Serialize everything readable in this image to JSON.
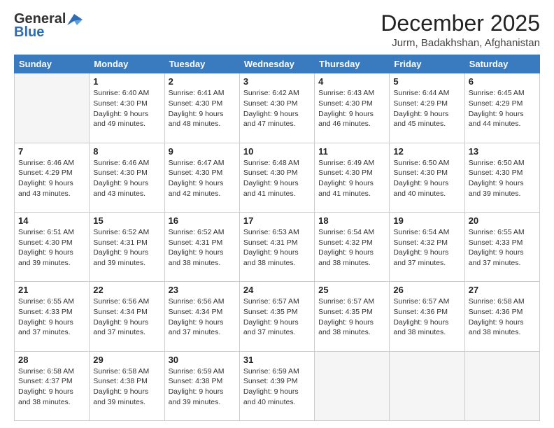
{
  "header": {
    "logo_line1": "General",
    "logo_line2": "Blue",
    "title": "December 2025",
    "subtitle": "Jurm, Badakhshan, Afghanistan"
  },
  "days_of_week": [
    "Sunday",
    "Monday",
    "Tuesday",
    "Wednesday",
    "Thursday",
    "Friday",
    "Saturday"
  ],
  "weeks": [
    [
      {
        "day": "",
        "info": ""
      },
      {
        "day": "1",
        "info": "Sunrise: 6:40 AM\nSunset: 4:30 PM\nDaylight: 9 hours\nand 49 minutes."
      },
      {
        "day": "2",
        "info": "Sunrise: 6:41 AM\nSunset: 4:30 PM\nDaylight: 9 hours\nand 48 minutes."
      },
      {
        "day": "3",
        "info": "Sunrise: 6:42 AM\nSunset: 4:30 PM\nDaylight: 9 hours\nand 47 minutes."
      },
      {
        "day": "4",
        "info": "Sunrise: 6:43 AM\nSunset: 4:30 PM\nDaylight: 9 hours\nand 46 minutes."
      },
      {
        "day": "5",
        "info": "Sunrise: 6:44 AM\nSunset: 4:29 PM\nDaylight: 9 hours\nand 45 minutes."
      },
      {
        "day": "6",
        "info": "Sunrise: 6:45 AM\nSunset: 4:29 PM\nDaylight: 9 hours\nand 44 minutes."
      }
    ],
    [
      {
        "day": "7",
        "info": "Sunrise: 6:46 AM\nSunset: 4:29 PM\nDaylight: 9 hours\nand 43 minutes."
      },
      {
        "day": "8",
        "info": "Sunrise: 6:46 AM\nSunset: 4:30 PM\nDaylight: 9 hours\nand 43 minutes."
      },
      {
        "day": "9",
        "info": "Sunrise: 6:47 AM\nSunset: 4:30 PM\nDaylight: 9 hours\nand 42 minutes."
      },
      {
        "day": "10",
        "info": "Sunrise: 6:48 AM\nSunset: 4:30 PM\nDaylight: 9 hours\nand 41 minutes."
      },
      {
        "day": "11",
        "info": "Sunrise: 6:49 AM\nSunset: 4:30 PM\nDaylight: 9 hours\nand 41 minutes."
      },
      {
        "day": "12",
        "info": "Sunrise: 6:50 AM\nSunset: 4:30 PM\nDaylight: 9 hours\nand 40 minutes."
      },
      {
        "day": "13",
        "info": "Sunrise: 6:50 AM\nSunset: 4:30 PM\nDaylight: 9 hours\nand 39 minutes."
      }
    ],
    [
      {
        "day": "14",
        "info": "Sunrise: 6:51 AM\nSunset: 4:30 PM\nDaylight: 9 hours\nand 39 minutes."
      },
      {
        "day": "15",
        "info": "Sunrise: 6:52 AM\nSunset: 4:31 PM\nDaylight: 9 hours\nand 39 minutes."
      },
      {
        "day": "16",
        "info": "Sunrise: 6:52 AM\nSunset: 4:31 PM\nDaylight: 9 hours\nand 38 minutes."
      },
      {
        "day": "17",
        "info": "Sunrise: 6:53 AM\nSunset: 4:31 PM\nDaylight: 9 hours\nand 38 minutes."
      },
      {
        "day": "18",
        "info": "Sunrise: 6:54 AM\nSunset: 4:32 PM\nDaylight: 9 hours\nand 38 minutes."
      },
      {
        "day": "19",
        "info": "Sunrise: 6:54 AM\nSunset: 4:32 PM\nDaylight: 9 hours\nand 37 minutes."
      },
      {
        "day": "20",
        "info": "Sunrise: 6:55 AM\nSunset: 4:33 PM\nDaylight: 9 hours\nand 37 minutes."
      }
    ],
    [
      {
        "day": "21",
        "info": "Sunrise: 6:55 AM\nSunset: 4:33 PM\nDaylight: 9 hours\nand 37 minutes."
      },
      {
        "day": "22",
        "info": "Sunrise: 6:56 AM\nSunset: 4:34 PM\nDaylight: 9 hours\nand 37 minutes."
      },
      {
        "day": "23",
        "info": "Sunrise: 6:56 AM\nSunset: 4:34 PM\nDaylight: 9 hours\nand 37 minutes."
      },
      {
        "day": "24",
        "info": "Sunrise: 6:57 AM\nSunset: 4:35 PM\nDaylight: 9 hours\nand 37 minutes."
      },
      {
        "day": "25",
        "info": "Sunrise: 6:57 AM\nSunset: 4:35 PM\nDaylight: 9 hours\nand 38 minutes."
      },
      {
        "day": "26",
        "info": "Sunrise: 6:57 AM\nSunset: 4:36 PM\nDaylight: 9 hours\nand 38 minutes."
      },
      {
        "day": "27",
        "info": "Sunrise: 6:58 AM\nSunset: 4:36 PM\nDaylight: 9 hours\nand 38 minutes."
      }
    ],
    [
      {
        "day": "28",
        "info": "Sunrise: 6:58 AM\nSunset: 4:37 PM\nDaylight: 9 hours\nand 38 minutes."
      },
      {
        "day": "29",
        "info": "Sunrise: 6:58 AM\nSunset: 4:38 PM\nDaylight: 9 hours\nand 39 minutes."
      },
      {
        "day": "30",
        "info": "Sunrise: 6:59 AM\nSunset: 4:38 PM\nDaylight: 9 hours\nand 39 minutes."
      },
      {
        "day": "31",
        "info": "Sunrise: 6:59 AM\nSunset: 4:39 PM\nDaylight: 9 hours\nand 40 minutes."
      },
      {
        "day": "",
        "info": ""
      },
      {
        "day": "",
        "info": ""
      },
      {
        "day": "",
        "info": ""
      }
    ]
  ]
}
